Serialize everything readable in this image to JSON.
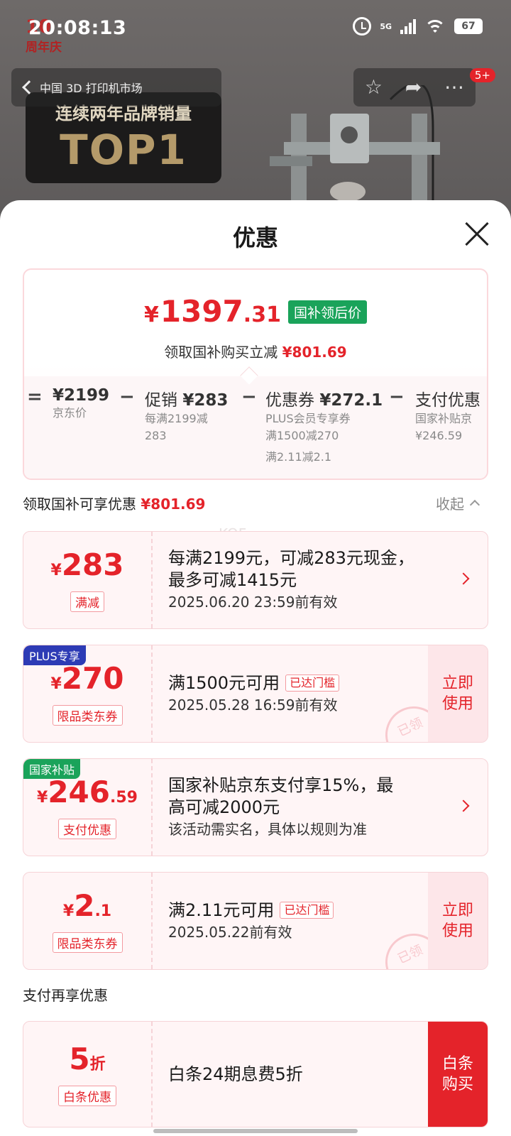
{
  "status_bar": {
    "time": "20:08:13",
    "network": "5G",
    "battery": "67"
  },
  "background": {
    "anniversary_top": "10",
    "anniversary_label": "周年庆",
    "nav_title": "中国 3D 打印机市场",
    "banner_line1": "连续两年品牌销量",
    "banner_line2": "TOP1",
    "badge": "5+"
  },
  "sheet": {
    "title": "优惠",
    "summary": {
      "yen": "¥",
      "price_int": "1397",
      "price_dec": ".31",
      "tag": "国补领后价",
      "save_text": "领取国补购买立减",
      "save_amount": "¥801.69",
      "breakdown": [
        {
          "op": "=",
          "main_label": "",
          "main_value": "¥2199",
          "sub1": "京东价",
          "sub2": "",
          "sub3": ""
        },
        {
          "op": "−",
          "main_label": "促销 ",
          "main_value": "¥283",
          "sub1": "每满2199减",
          "sub2": "283",
          "sub3": ""
        },
        {
          "op": "−",
          "main_label": "优惠券 ",
          "main_value": "¥272.1",
          "sub1": "PLUS会员专享券",
          "sub2": "满1500减270",
          "sub3": "满2.11减2.1"
        },
        {
          "op": "−",
          "main_label": "支付优惠",
          "main_value": "",
          "sub1": "国家补贴京",
          "sub2": "¥246.59",
          "sub3": ""
        }
      ]
    },
    "section1": {
      "label": "领取国补可享优惠",
      "amount": "¥801.69",
      "collapse": "收起"
    },
    "watermark": "KOF",
    "coupons": [
      {
        "yen": "¥",
        "amount": "283",
        "dec": "",
        "type": "满减",
        "corner": "",
        "title": "每满2199元，可减283元现金，",
        "title2": "最多可减1415元",
        "reached": "",
        "sub": "2025.06.20 23:59前有效",
        "action": "",
        "stamp": ""
      },
      {
        "yen": "¥",
        "amount": "270",
        "dec": "",
        "type": "限品类东券",
        "corner": "PLUS专享",
        "title": "满1500元可用",
        "title2": "",
        "reached": "已达门槛",
        "sub": "2025.05.28 16:59前有效",
        "action": "立即使用",
        "stamp": "已领"
      },
      {
        "yen": "¥",
        "amount": "246",
        "dec": ".59",
        "type": "支付优惠",
        "corner": "国家补贴",
        "title": "国家补贴京东支付享15%，最",
        "title2": "高可减2000元",
        "reached": "",
        "sub": "该活动需实名，具体以规则为准",
        "action": "",
        "stamp": ""
      },
      {
        "yen": "¥",
        "amount": "2",
        "dec": ".1",
        "type": "限品类东券",
        "corner": "",
        "title": "满2.11元可用",
        "title2": "",
        "reached": "已达门槛",
        "sub": "2025.05.22前有效",
        "action": "立即使用",
        "stamp": "已领"
      }
    ],
    "section2": {
      "label": "支付再享优惠"
    },
    "pay_coupon": {
      "amount": "5",
      "unit": "折",
      "type": "白条优惠",
      "title": "白条24期息费5折",
      "action_line1": "白条",
      "action_line2": "购买"
    }
  },
  "colors": {
    "accent": "#e4232a",
    "gov_green": "#1aa35a",
    "plus_blue": "#2d3bb5"
  }
}
